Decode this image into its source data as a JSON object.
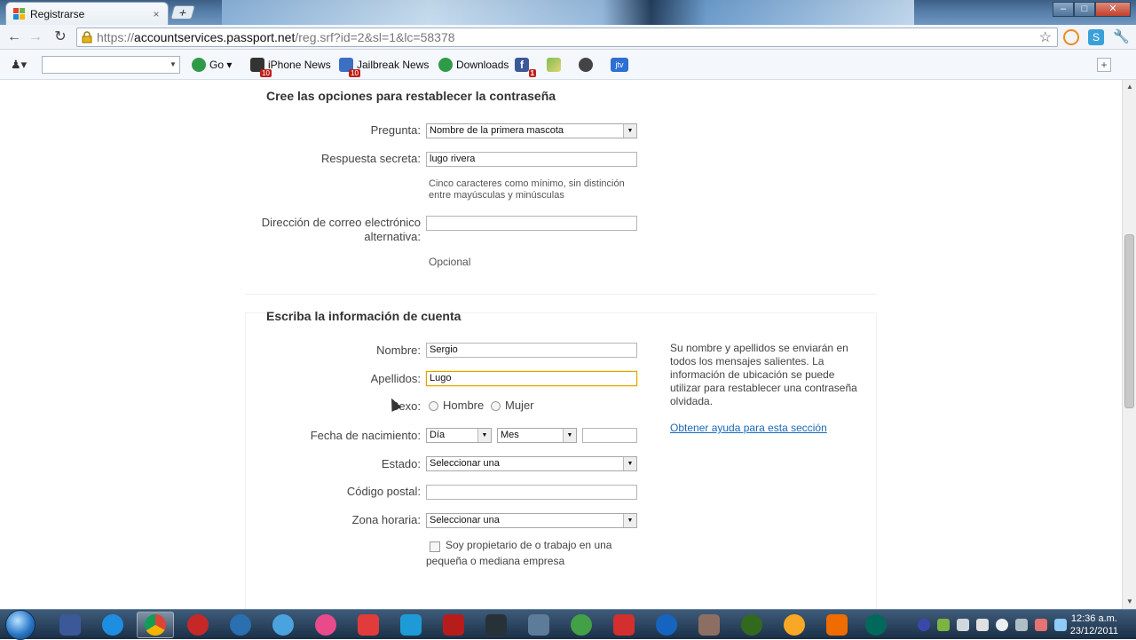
{
  "browser": {
    "tab_title": "Registrarse",
    "tab_close": "×",
    "new_tab": "+",
    "url_scheme": "https://",
    "url_host": "accountservices.passport.net",
    "url_path": "/reg.srf?id=2&sl=1&lc=58378"
  },
  "bookmarks": {
    "go_label": "Go",
    "items": [
      {
        "label": "iPhone News",
        "badge": "10"
      },
      {
        "label": "Jailbreak News",
        "badge": "10"
      },
      {
        "label": "Downloads"
      }
    ],
    "fb_badge": "1",
    "jtv_label": "jtv"
  },
  "form": {
    "recovery": {
      "title": "Cree las opciones para restablecer la contraseña",
      "question_label": "Pregunta:",
      "question_value": "Nombre de la primera mascota",
      "answer_label": "Respuesta secreta:",
      "answer_value": "lugo rivera",
      "answer_hint_1": "Cinco caracteres como mínimo, sin distinción",
      "answer_hint_2": "entre mayúsculas y minúsculas",
      "alt_email_label_1": "Dirección de correo electrónico",
      "alt_email_label_2": "alternativa:",
      "alt_email_value": "",
      "optional_hint": "Opcional"
    },
    "account": {
      "title": "Escriba la información de cuenta",
      "first_name_label": "Nombre:",
      "first_name_value": "Sergio",
      "last_name_label": "Apellidos:",
      "last_name_value": "Lugo",
      "gender_label": "Sexo:",
      "gender_options": [
        "Hombre",
        "Mujer"
      ],
      "birth_label": "Fecha de nacimiento:",
      "birth_day": "Día",
      "birth_month": "Mes",
      "birth_year": "",
      "state_label": "Estado:",
      "state_value": "Seleccionar una",
      "zip_label": "Código postal:",
      "zip_value": "",
      "timezone_label": "Zona horaria:",
      "timezone_value": "Seleccionar una",
      "business_line_1": "Soy propietario de o trabajo en una",
      "business_line_2": "pequeña o mediana empresa",
      "side_line_1": "Su nombre y apellidos se enviarán en",
      "side_line_2": "todos los mensajes salientes. La",
      "side_line_3": "información de ubicación se puede",
      "side_line_4": "utilizar para restablecer una contraseña",
      "side_line_5": "olvidada.",
      "help_link": "Obtener ayuda para esta sección"
    }
  },
  "taskbar": {
    "time": "12:36 a.m.",
    "date": "23/12/2011"
  }
}
